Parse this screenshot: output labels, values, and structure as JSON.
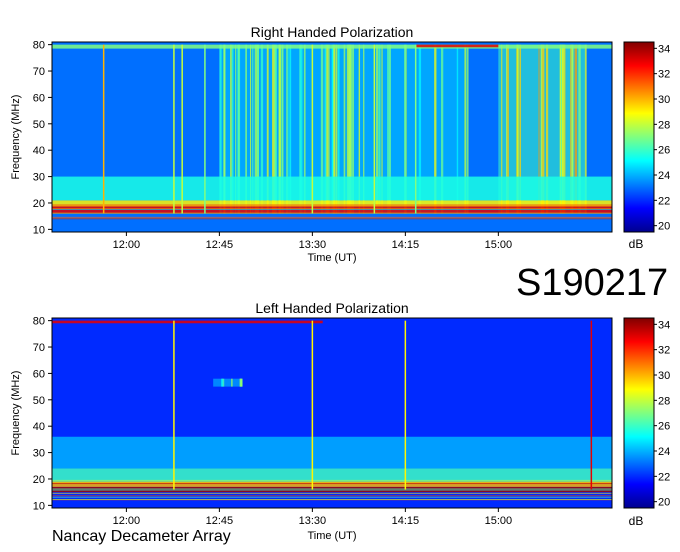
{
  "identifier": "S190217",
  "footer": "Nancay Decameter Array",
  "colorbar": {
    "unit": "dB",
    "min": 19.5,
    "max": 34.5,
    "ticks": [
      20,
      22,
      24,
      26,
      28,
      30,
      32,
      34
    ],
    "tick_labels": [
      "20",
      "22",
      "24",
      "26",
      "28",
      "30",
      "32",
      "34"
    ],
    "colormap": "jet"
  },
  "chart_data": [
    {
      "type": "heatmap",
      "title": "Right Handed Polarization",
      "xlabel": "Time (UT)",
      "ylabel": "Frequency (MHz)",
      "xlim": [
        "11:24",
        "15:55"
      ],
      "ylim": [
        9,
        81
      ],
      "xticks": [
        "12:00",
        "12:45",
        "13:30",
        "14:15",
        "15:00"
      ],
      "yticks": [
        10,
        20,
        30,
        40,
        50,
        60,
        70,
        80
      ],
      "ytick_labels": [
        "10",
        "20",
        "30",
        "40",
        "50",
        "60",
        "70",
        "80"
      ],
      "background_level_db": 23,
      "bands": [
        {
          "freq": [
            16,
            19
          ],
          "time": [
            "11:24",
            "15:55"
          ],
          "level_db": 33
        },
        {
          "freq": [
            19,
            21
          ],
          "time": [
            "11:24",
            "15:55"
          ],
          "level_db": 29
        },
        {
          "freq": [
            21,
            30
          ],
          "time": [
            "11:24",
            "15:55"
          ],
          "level_db": 25.5
        },
        {
          "freq": [
            78.5,
            80
          ],
          "time": [
            "11:24",
            "15:55"
          ],
          "level_db": 27
        },
        {
          "freq": [
            79,
            80
          ],
          "time": [
            "14:20",
            "15:00"
          ],
          "level_db": 33
        }
      ],
      "spikes": [
        {
          "time": "11:49",
          "freq": [
            16,
            80
          ],
          "level_db": 30
        },
        {
          "time": "12:23",
          "freq": [
            16,
            80
          ],
          "level_db": 28
        },
        {
          "time": "12:27",
          "freq": [
            16,
            80
          ],
          "level_db": 28
        },
        {
          "time": "12:38",
          "freq": [
            16,
            80
          ],
          "level_db": 27
        },
        {
          "time": "13:30",
          "freq": [
            16,
            80
          ],
          "level_db": 28
        },
        {
          "time": "14:00",
          "freq": [
            16,
            80
          ],
          "level_db": 28
        },
        {
          "time": "14:20",
          "freq": [
            16,
            80
          ],
          "level_db": 27
        }
      ],
      "burst_regions": [
        {
          "time": [
            "12:45",
            "14:45"
          ],
          "freq": [
            16,
            80
          ],
          "level_db": 27
        },
        {
          "time": [
            "15:00",
            "15:42"
          ],
          "freq": [
            16,
            80
          ],
          "level_db": 28.5
        }
      ]
    },
    {
      "type": "heatmap",
      "title": "Left Handed Polarization",
      "xlabel": "Time (UT)",
      "ylabel": "Frequency (MHz)",
      "xlim": [
        "11:24",
        "15:55"
      ],
      "ylim": [
        9,
        81
      ],
      "xticks": [
        "12:00",
        "12:45",
        "13:30",
        "14:15",
        "15:00"
      ],
      "yticks": [
        10,
        20,
        30,
        40,
        50,
        60,
        70,
        80
      ],
      "ytick_labels": [
        "10",
        "20",
        "30",
        "40",
        "50",
        "60",
        "70",
        "80"
      ],
      "background_level_db": 22,
      "bands": [
        {
          "freq": [
            15,
            17
          ],
          "time": [
            "11:24",
            "15:55"
          ],
          "level_db": 34
        },
        {
          "freq": [
            17,
            19
          ],
          "time": [
            "11:24",
            "15:55"
          ],
          "level_db": 30
        },
        {
          "freq": [
            19,
            24
          ],
          "time": [
            "11:24",
            "15:55"
          ],
          "level_db": 26
        },
        {
          "freq": [
            24,
            36
          ],
          "time": [
            "11:24",
            "15:55"
          ],
          "level_db": 24
        },
        {
          "freq": [
            79,
            80
          ],
          "time": [
            "11:24",
            "13:35"
          ],
          "level_db": 33
        }
      ],
      "spikes": [
        {
          "time": "12:23",
          "freq": [
            16,
            80
          ],
          "level_db": 29
        },
        {
          "time": "13:30",
          "freq": [
            16,
            80
          ],
          "level_db": 29
        },
        {
          "time": "14:15",
          "freq": [
            16,
            80
          ],
          "level_db": 29
        },
        {
          "time": "15:45",
          "freq": [
            16,
            80
          ],
          "level_db": 33
        }
      ],
      "burst_regions": [
        {
          "time": [
            "12:42",
            "12:56"
          ],
          "freq": [
            55,
            58
          ],
          "level_db": 27
        }
      ]
    }
  ]
}
